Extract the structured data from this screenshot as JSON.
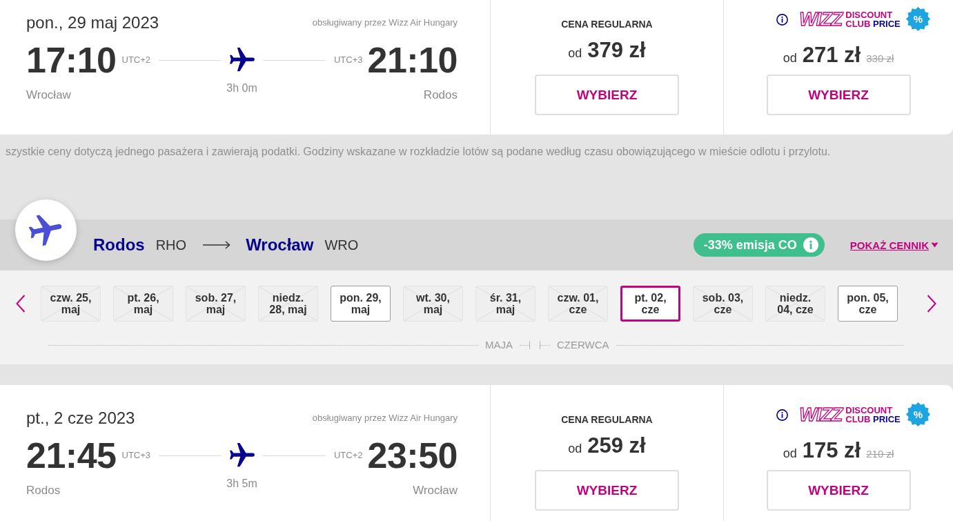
{
  "outbound_flight": {
    "date": "pon., 29 maj 2023",
    "operator": "obsługiwany przez Wizz Air Hungary",
    "departure": {
      "time": "17:10",
      "timezone": "UTC+2",
      "city": "Wrocław"
    },
    "duration": "3h 0m",
    "arrival": {
      "time": "21:10",
      "timezone": "UTC+3",
      "city": "Rodos"
    },
    "regular_fare": {
      "label": "CENA REGULARNA",
      "prefix": "od",
      "price": "379 zł",
      "button": "WYBIERZ"
    },
    "club_fare": {
      "logo": "WIZZ",
      "label_line_1": "DISCOUNT",
      "label_line_2": "CLUB",
      "label_accent": "PRICE",
      "badge": "%",
      "prefix": "od",
      "price": "271 zł",
      "old_price": "330 zł",
      "button": "WYBIERZ"
    }
  },
  "notice": "szystkie ceny dotyczą jednego pasażera i zawierają podatki. Godziny wskazane w rozkładzie lotów są podane według czasu obowiązującego w mieście odlotu i przylotu.",
  "route": {
    "origin": {
      "city": "Rodos",
      "code": "RHO"
    },
    "destination": {
      "city": "Wrocław",
      "code": "WRO"
    },
    "emission_badge": "-33% emisja CO",
    "price_list_link": "POKAŻ CENNIK"
  },
  "date_strip": {
    "dates": [
      {
        "lines": [
          "czw. 25,",
          "maj"
        ],
        "available": false,
        "selected": false
      },
      {
        "lines": [
          "pt. 26,",
          "maj"
        ],
        "available": false,
        "selected": false
      },
      {
        "lines": [
          "sob. 27,",
          "maj"
        ],
        "available": false,
        "selected": false
      },
      {
        "lines": [
          "niedz.",
          "28, maj"
        ],
        "available": false,
        "selected": false
      },
      {
        "lines": [
          "pon. 29,",
          "maj"
        ],
        "available": true,
        "selected": false
      },
      {
        "lines": [
          "wt. 30,",
          "maj"
        ],
        "available": false,
        "selected": false
      },
      {
        "lines": [
          "śr. 31,",
          "maj"
        ],
        "available": false,
        "selected": false
      },
      {
        "lines": [
          "czw. 01,",
          "cze"
        ],
        "available": false,
        "selected": false
      },
      {
        "lines": [
          "pt. 02,",
          "cze"
        ],
        "available": true,
        "selected": true
      },
      {
        "lines": [
          "sob. 03,",
          "cze"
        ],
        "available": false,
        "selected": false
      },
      {
        "lines": [
          "niedz.",
          "04, cze"
        ],
        "available": false,
        "selected": false
      },
      {
        "lines": [
          "pon. 05,",
          "cze"
        ],
        "available": true,
        "selected": false
      }
    ],
    "months": [
      "MAJA",
      "CZERWCA"
    ]
  },
  "return_flight": {
    "date": "pt., 2 cze 2023",
    "operator": "obsługiwany przez Wizz Air Hungary",
    "departure": {
      "time": "21:45",
      "timezone": "UTC+3",
      "city": "Rodos"
    },
    "duration": "3h 5m",
    "arrival": {
      "time": "23:50",
      "timezone": "UTC+2",
      "city": "Wrocław"
    },
    "regular_fare": {
      "label": "CENA REGULARNA",
      "prefix": "od",
      "price": "259 zł",
      "button": "WYBIERZ"
    },
    "club_fare": {
      "logo": "WIZZ",
      "label_line_1": "DISCOUNT",
      "label_line_2": "CLUB",
      "label_accent": "PRICE",
      "badge": "%",
      "prefix": "od",
      "price": "175 zł",
      "old_price": "210 zł",
      "button": "WYBIERZ"
    }
  }
}
